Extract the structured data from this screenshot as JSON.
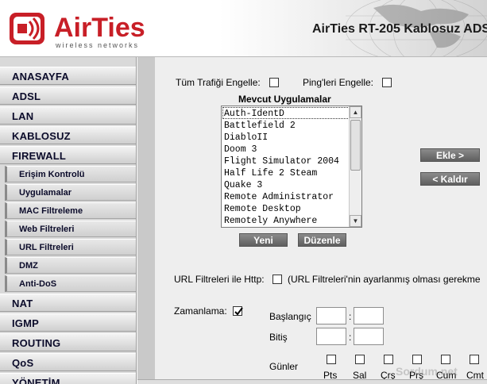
{
  "header": {
    "brand": "AirTies",
    "tagline": "wireless networks",
    "product_title": "AirTies RT-205 Kablosuz ADS"
  },
  "sidebar": {
    "main_items": [
      "ANASAYFA",
      "ADSL",
      "LAN",
      "KABLOSUZ",
      "FIREWALL"
    ],
    "firewall_subitems": [
      "Erişim Kontrolü",
      "Uygulamalar",
      "MAC Filtreleme",
      "Web Filtreleri",
      "URL Filtreleri",
      "DMZ",
      "Anti-DoS"
    ],
    "lower_items": [
      "NAT",
      "IGMP",
      "ROUTING",
      "QoS",
      "YÖNETİM"
    ]
  },
  "options": {
    "block_all_traffic_label": "Tüm Trafiği Engelle:",
    "block_ping_label": "Ping'leri Engelle:"
  },
  "apps": {
    "title": "Mevcut Uygulamalar",
    "items": [
      "Auth-IdentD",
      "Battlefield 2",
      "DiabloII",
      "Doom 3",
      "Flight Simulator 2004",
      "Half Life 2 Steam",
      "Quake 3",
      "Remote Administrator",
      "Remote Desktop",
      "Remotely Anywhere"
    ]
  },
  "buttons": {
    "add": "Ekle >",
    "remove": "< Kaldır",
    "new": "Yeni",
    "edit": "Düzenle"
  },
  "url_filter": {
    "label": "URL Filtreleri ile Http:",
    "note": "(URL Filtreleri'nin ayarlanmış olması gerekme"
  },
  "schedule": {
    "label": "Zamanlama:",
    "checked": true,
    "start_label": "Başlangıç",
    "end_label": "Bitiş",
    "days_label": "Günler",
    "days": [
      "Pts",
      "Sal",
      "Çrş",
      "Prş",
      "Cum",
      "Cmt"
    ],
    "separator": ":"
  },
  "watermark": "Sordum.net"
}
